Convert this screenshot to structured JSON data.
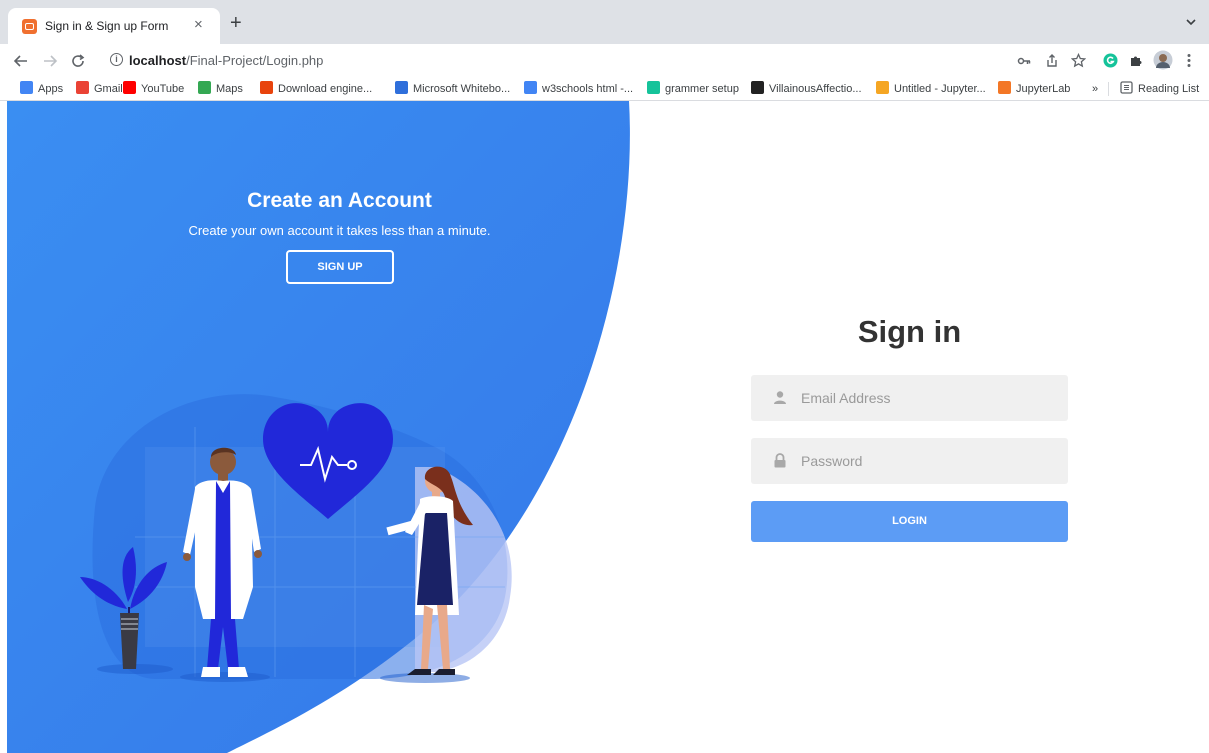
{
  "browser": {
    "tab_title": "Sign in & Sign up Form",
    "tab_close": "×",
    "new_tab": "+",
    "url_host": "localhost",
    "url_path": "/Final-Project/Login.php",
    "bookmarks": [
      {
        "label": "Apps",
        "icon": "apps-grid-icon",
        "color": "#4285f4"
      },
      {
        "label": "Gmail",
        "icon": "gmail-icon",
        "color": "#ea4335"
      },
      {
        "label": "YouTube",
        "icon": "youtube-icon",
        "color": "#ff0000"
      },
      {
        "label": "Maps",
        "icon": "maps-icon",
        "color": "#34a853"
      },
      {
        "label": "Download engine...",
        "icon": "x-icon",
        "color": "#e8430c"
      },
      {
        "label": "Microsoft Whitebo...",
        "icon": "whiteboard-icon",
        "color": "#2f6fdb"
      },
      {
        "label": "w3schools html -...",
        "icon": "google-icon",
        "color": "#4285f4"
      },
      {
        "label": "grammer setup",
        "icon": "grammarly-icon",
        "color": "#15c39a"
      },
      {
        "label": "VillainousAffectio...",
        "icon": "replit-icon",
        "color": "#222222"
      },
      {
        "label": "Untitled - Jupyter...",
        "icon": "notebook-icon",
        "color": "#f5a623"
      },
      {
        "label": "JupyterLab",
        "icon": "jupyter-icon",
        "color": "#f37726"
      }
    ],
    "bookmarks_overflow": "»",
    "reading_list": "Reading List"
  },
  "promo": {
    "title": "Create an Account",
    "subtitle": "Create your own account it takes less than a minute.",
    "signup_label": "SIGN UP"
  },
  "signin": {
    "title": "Sign in",
    "email_placeholder": "Email Address",
    "password_placeholder": "Password",
    "login_label": "LOGIN"
  },
  "colors": {
    "panel_blue": "#3d8ef0",
    "login_blue": "#5c9cf5",
    "heart_blue": "#2128d9",
    "field_bg": "#f0f0f0"
  }
}
